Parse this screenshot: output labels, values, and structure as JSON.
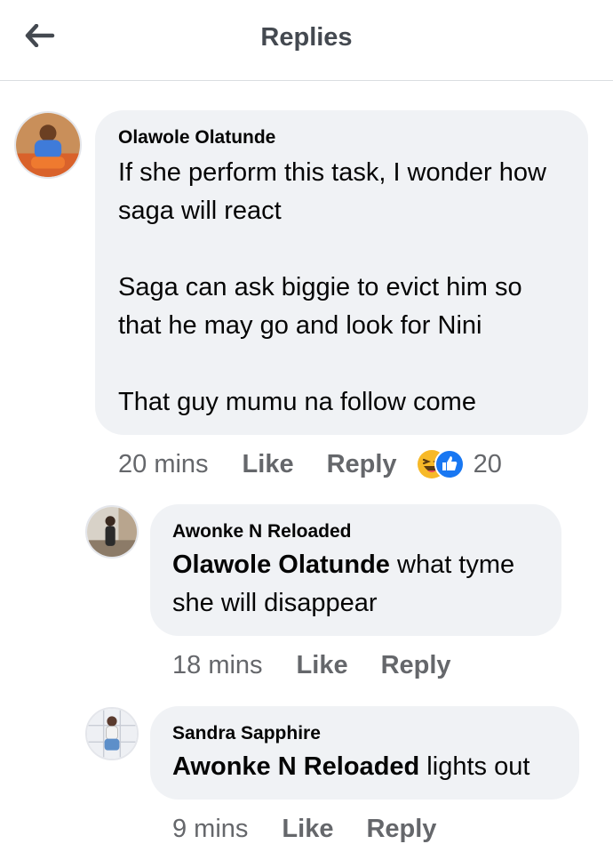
{
  "header": {
    "title": "Replies",
    "back_icon": "arrow-left-icon"
  },
  "colors": {
    "bubble": "#f0f2f5",
    "meta": "#65676b",
    "like_blue": "#1877f2",
    "haha_yellow": "#f7b928"
  },
  "comment": {
    "author": "Olawole Olatunde",
    "text": "If she perform this task, I wonder how saga will react\n\nSaga can ask biggie to evict him so that he may go and look for Nini\n\nThat guy mumu na follow come",
    "time": "20 mins",
    "like_label": "Like",
    "reply_label": "Reply",
    "reaction_count": "20",
    "reaction_icons": [
      "haha-icon",
      "like-icon"
    ]
  },
  "replies": [
    {
      "author": "Awonke N Reloaded",
      "mention": "Olawole Olatunde",
      "text": " what tyme she will disappear",
      "time": "18 mins",
      "like_label": "Like",
      "reply_label": "Reply"
    },
    {
      "author": "Sandra Sapphire",
      "mention": "Awonke N Reloaded",
      "text": " lights out",
      "time": "9 mins",
      "like_label": "Like",
      "reply_label": "Reply"
    }
  ]
}
